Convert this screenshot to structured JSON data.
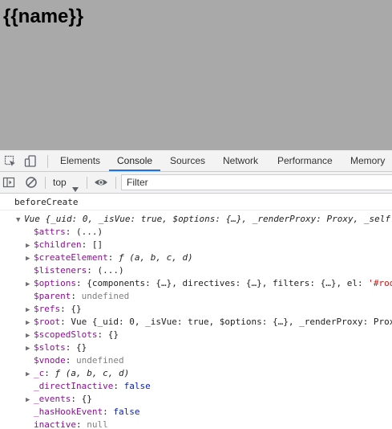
{
  "page": {
    "heading": "{{name}}"
  },
  "devtools": {
    "tabs": [
      "Elements",
      "Console",
      "Sources",
      "Network",
      "Performance",
      "Memory"
    ],
    "active_tab": "Console",
    "accent_color": "#1a73e8"
  },
  "console_toolbar": {
    "context": "top",
    "filter_placeholder": "Filter"
  },
  "console": {
    "message": "beforeCreate",
    "object_preview": {
      "prefix": "Vue ",
      "body": "{_uid: 0, _isVue: true, $options: {…}, _renderProxy: Proxy, _self: "
    },
    "properties": [
      {
        "key": "$attrs",
        "value": "(...)",
        "expandable": false,
        "kind": "plain"
      },
      {
        "key": "$children",
        "value": "[]",
        "expandable": true,
        "kind": "plain"
      },
      {
        "key": "$createElement",
        "value": "ƒ (a, b, c, d)",
        "expandable": true,
        "kind": "fn"
      },
      {
        "key": "$listeners",
        "value": "(...)",
        "expandable": false,
        "kind": "plain"
      },
      {
        "key": "$options",
        "value": "{components: {…}, directives: {…}, filters: {…}, el: ",
        "value_tail": "'#roo",
        "expandable": true,
        "kind": "plain"
      },
      {
        "key": "$parent",
        "value": "undefined",
        "expandable": false,
        "kind": "null"
      },
      {
        "key": "$refs",
        "value": "{}",
        "expandable": true,
        "kind": "plain"
      },
      {
        "key": "$root",
        "value": "Vue {_uid: 0, _isVue: true, $options: {…}, _renderProxy: Prox",
        "expandable": true,
        "kind": "plain"
      },
      {
        "key": "$scopedSlots",
        "value": "{}",
        "expandable": true,
        "kind": "plain"
      },
      {
        "key": "$slots",
        "value": "{}",
        "expandable": true,
        "kind": "plain"
      },
      {
        "key": "$vnode",
        "value": "undefined",
        "expandable": false,
        "kind": "null"
      },
      {
        "key": "_c",
        "value": "ƒ (a, b, c, d)",
        "expandable": true,
        "kind": "fn"
      },
      {
        "key": "_directInactive",
        "value": "false",
        "expandable": false,
        "kind": "bool"
      },
      {
        "key": "_events",
        "value": "{}",
        "expandable": true,
        "kind": "plain"
      },
      {
        "key": "_hasHookEvent",
        "value": "false",
        "expandable": false,
        "kind": "bool"
      },
      {
        "key": "inactive",
        "value": "null",
        "expandable": false,
        "kind": "null"
      }
    ]
  }
}
